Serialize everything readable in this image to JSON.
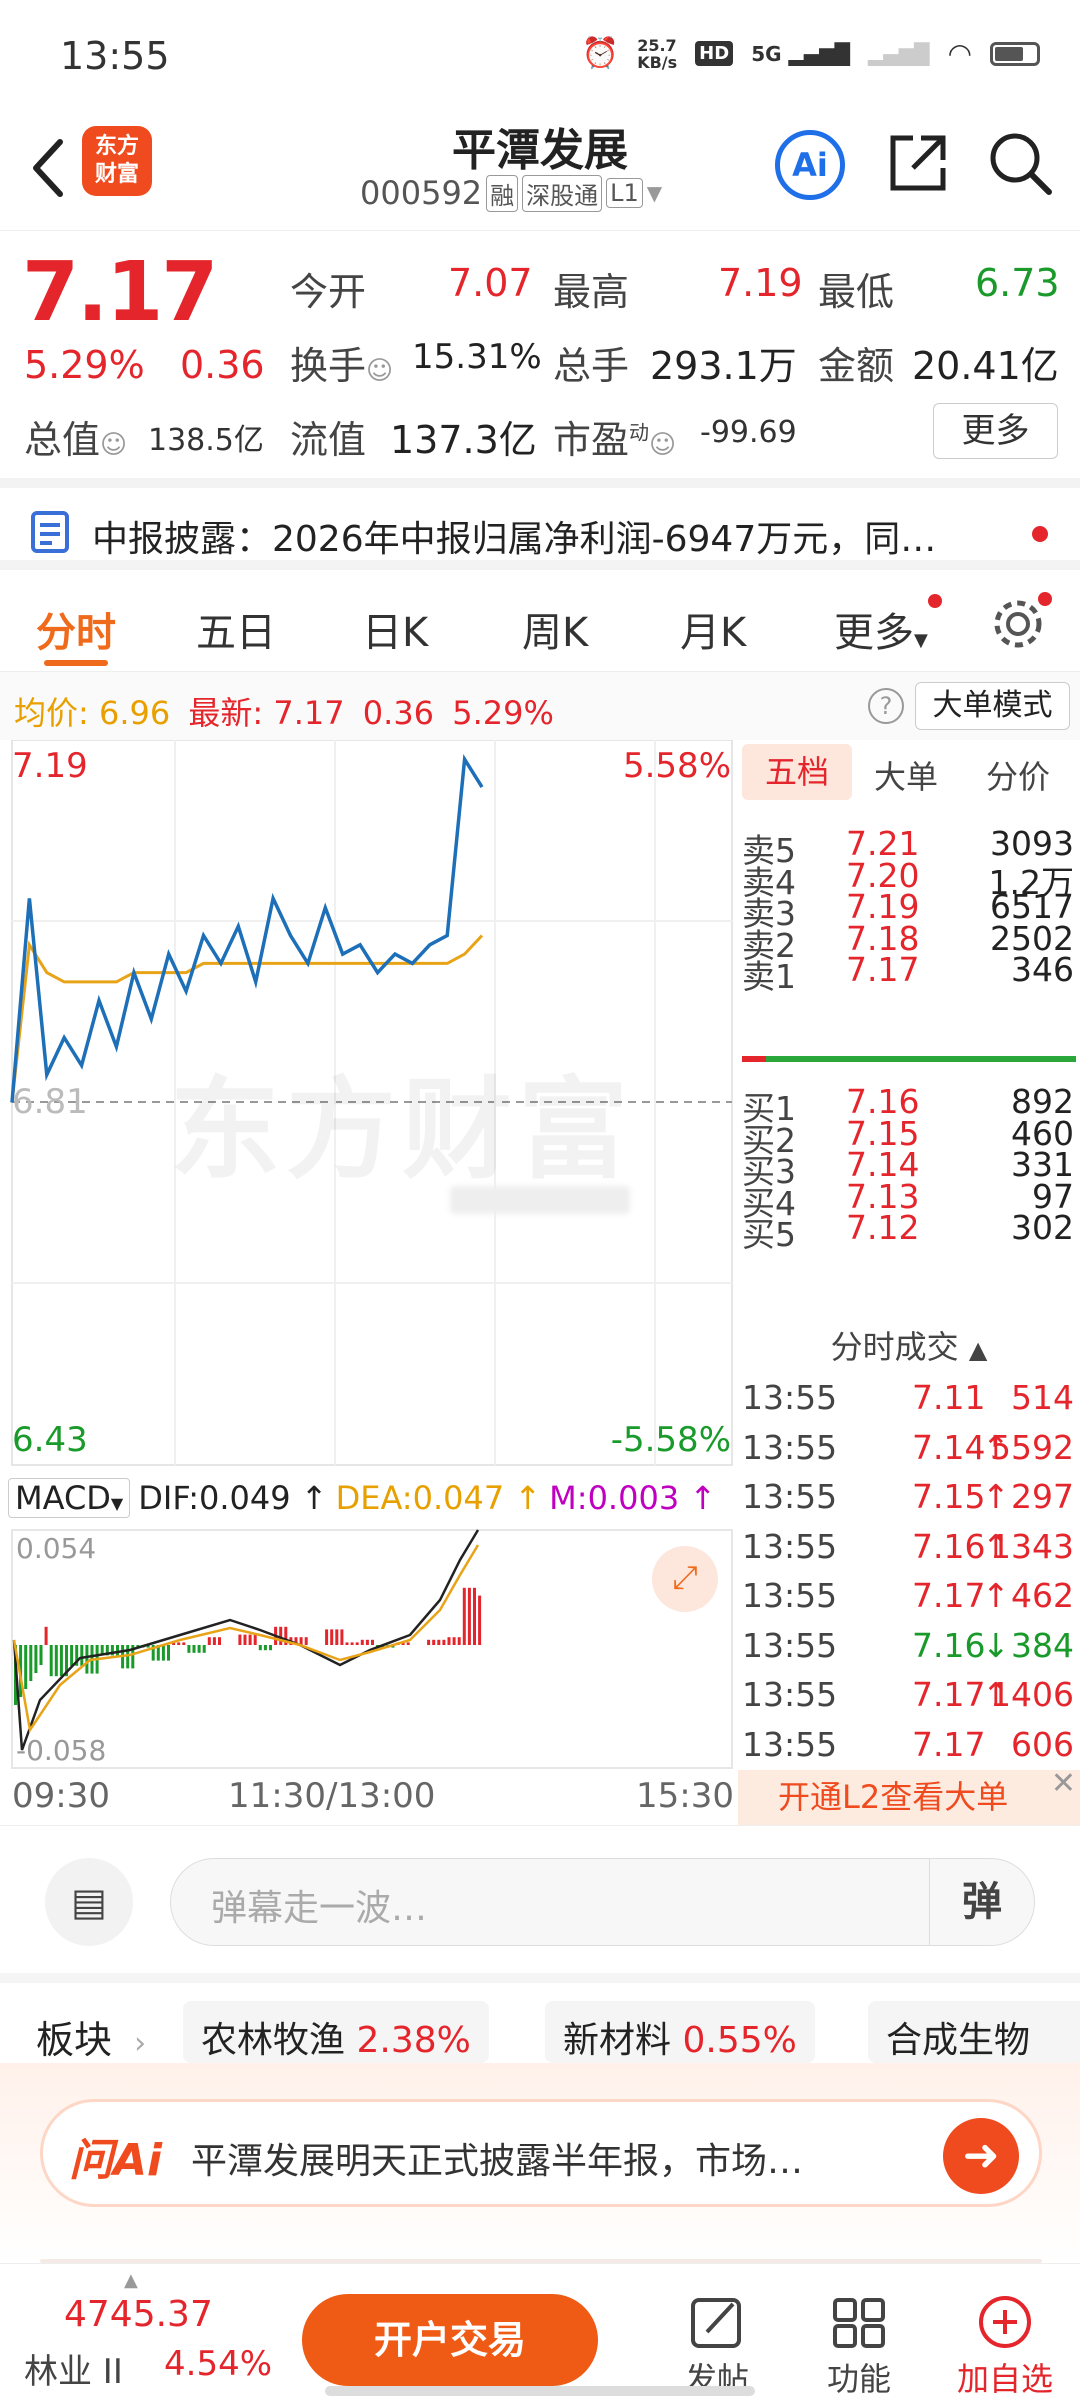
{
  "status": {
    "time": "13:55",
    "speed": "25.7\nKB/s",
    "hd": "HD",
    "net": "5G"
  },
  "header": {
    "logo": "东方\n财富",
    "title": "平潭发展",
    "code": "000592",
    "tag1": "融",
    "tag2": "深股通",
    "tag3": "L1"
  },
  "quote": {
    "price": "7.17",
    "pct": "5.29%",
    "chg": "0.36",
    "open_label": "今开",
    "open": "7.07",
    "high_label": "最高",
    "high": "7.19",
    "low_label": "最低",
    "low": "6.73",
    "turnover_label": "换手",
    "turnover": "15.31%",
    "volume_label": "总手",
    "volume": "293.1万",
    "amount_label": "金额",
    "amount": "20.41亿",
    "mcap_label": "总值",
    "mcap": "138.5亿",
    "float_label": "流值",
    "float": "137.3亿",
    "pe_label": "市盈",
    "pe_sup": "动",
    "pe": "-99.69",
    "more_button": "更多"
  },
  "notice": {
    "text": "中报披露：2026年中报归属净利润-6947万元，同…"
  },
  "tabs": [
    "分时",
    "五日",
    "日K",
    "周K",
    "月K",
    "更多"
  ],
  "avgline": {
    "avg_label": "均价:",
    "avg": "6.96",
    "last_label": "最新:",
    "last": "7.17",
    "chg": "0.36",
    "pct": "5.29%",
    "mode_button": "大单模式"
  },
  "chart": {
    "max_price": "7.19",
    "max_pct": "5.58%",
    "ref_price": "6.81",
    "min_price": "6.43",
    "min_pct": "-5.58%",
    "watermark": "东方财富",
    "macd_label": "MACD",
    "dif": "DIF:0.049 ↑",
    "dea": "DEA:0.047 ↑",
    "m": "M:0.003 ↑",
    "macd_max": "0.054",
    "macd_min": "-0.058",
    "t_start": "09:30",
    "t_mid": "11:30/13:00",
    "t_end": "15:30"
  },
  "chart_data": {
    "type": "line",
    "series": [
      {
        "values": [
          6.81,
          7.03,
          6.84,
          6.88,
          6.85,
          6.92,
          6.87,
          6.95,
          6.9,
          6.97,
          6.93,
          6.99,
          6.96,
          7.0,
          6.94,
          7.03,
          6.99,
          6.96,
          7.02,
          6.97,
          6.98,
          6.95,
          6.97,
          6.96,
          6.98,
          6.99,
          7.18,
          7.15
        ]
      },
      {
        "values": [
          6.81,
          6.98,
          6.95,
          6.94,
          6.94,
          6.94,
          6.94,
          6.95,
          6.95,
          6.95,
          6.95,
          6.96,
          6.96,
          6.96,
          6.96,
          6.96,
          6.96,
          6.96,
          6.96,
          6.96,
          6.96,
          6.96,
          6.96,
          6.96,
          6.96,
          6.96,
          6.97,
          6.99
        ]
      }
    ],
    "ylim": [
      6.43,
      7.19
    ],
    "x": [
      "09:30",
      "11:30/13:00",
      "15:30"
    ]
  },
  "book": {
    "tabs": [
      "五档",
      "大单",
      "分价"
    ],
    "asks": [
      {
        "l": "卖5",
        "p": "7.21",
        "v": "3093"
      },
      {
        "l": "卖4",
        "p": "7.20",
        "v": "1.2万"
      },
      {
        "l": "卖3",
        "p": "7.19",
        "v": "6517"
      },
      {
        "l": "卖2",
        "p": "7.18",
        "v": "2502"
      },
      {
        "l": "卖1",
        "p": "7.17",
        "v": "346"
      }
    ],
    "bids": [
      {
        "l": "买1",
        "p": "7.16",
        "v": "892"
      },
      {
        "l": "买2",
        "p": "7.15",
        "v": "460"
      },
      {
        "l": "买3",
        "p": "7.14",
        "v": "331"
      },
      {
        "l": "买4",
        "p": "7.13",
        "v": "97"
      },
      {
        "l": "买5",
        "p": "7.12",
        "v": "302"
      }
    ],
    "trades_title": "分时成交",
    "trades": [
      {
        "t": "13:55",
        "p": "7.11",
        "a": "",
        "v": "514",
        "c": "red"
      },
      {
        "t": "13:55",
        "p": "7.14",
        "a": "↑",
        "v": "5592",
        "c": "red"
      },
      {
        "t": "13:55",
        "p": "7.15",
        "a": "↑",
        "v": "297",
        "c": "red"
      },
      {
        "t": "13:55",
        "p": "7.16",
        "a": "↑",
        "v": "1343",
        "c": "red"
      },
      {
        "t": "13:55",
        "p": "7.17",
        "a": "↑",
        "v": "462",
        "c": "red"
      },
      {
        "t": "13:55",
        "p": "7.16",
        "a": "↓",
        "v": "384",
        "c": "green"
      },
      {
        "t": "13:55",
        "p": "7.17",
        "a": "↑",
        "v": "1406",
        "c": "red"
      },
      {
        "t": "13:55",
        "p": "7.17",
        "a": "",
        "v": "606",
        "c": "red"
      }
    ],
    "l2_banner": "开通L2查看大单"
  },
  "danmu": {
    "placeholder": "弹幕走一波…",
    "button": "弹"
  },
  "sectors": {
    "label": "板块",
    "items": [
      {
        "n": "农林牧渔",
        "v": "2.38%"
      },
      {
        "n": "新材料",
        "v": "0.55%"
      },
      {
        "n": "合成生物",
        "v": ""
      }
    ]
  },
  "askai": {
    "logo": "问Ai",
    "text": "平潭发展明天正式披露半年报，市场…"
  },
  "bottom": {
    "index_value": "4745.37",
    "index_name": "林业 II",
    "index_pct": "4.54%",
    "trade_button": "开户交易",
    "post": "发帖",
    "func": "功能",
    "add": "加自选"
  }
}
